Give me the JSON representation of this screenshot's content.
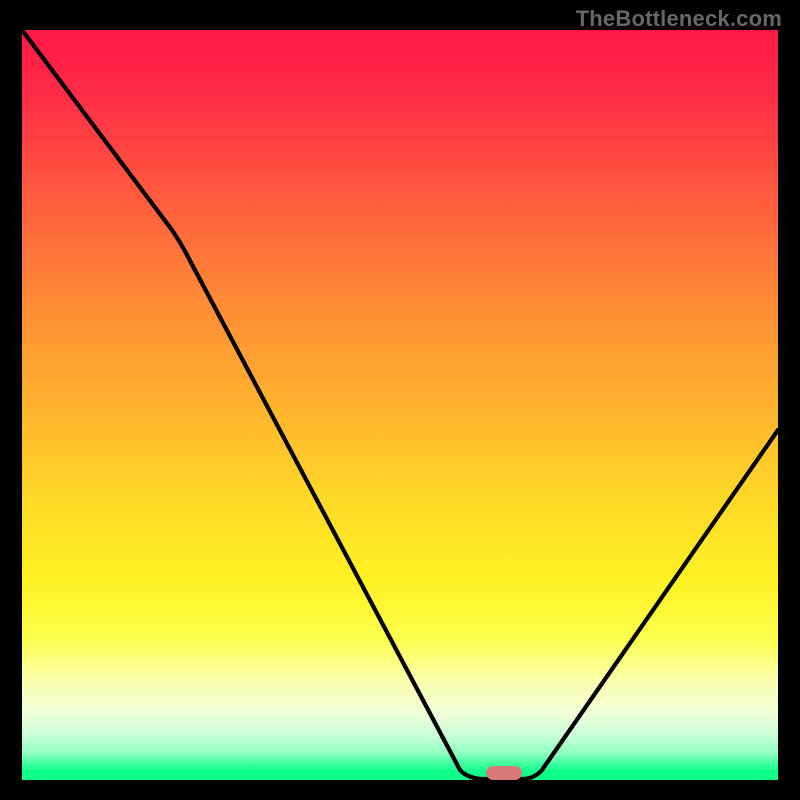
{
  "watermark": "TheBottleneck.com",
  "chart_data": {
    "type": "line",
    "title": "",
    "xlabel": "",
    "ylabel": "",
    "xlim": [
      0,
      100
    ],
    "ylim": [
      0,
      100
    ],
    "x": [
      0,
      20,
      58,
      63,
      67,
      100
    ],
    "values": [
      100,
      73,
      1,
      0,
      0,
      47
    ],
    "marker": {
      "x_start": 62,
      "x_end": 67,
      "y": 0
    },
    "background_gradient": [
      {
        "pos": 0,
        "color": "#ff1845"
      },
      {
        "pos": 0.5,
        "color": "#ffb22e"
      },
      {
        "pos": 0.73,
        "color": "#fff122"
      },
      {
        "pos": 0.96,
        "color": "#8effbe"
      },
      {
        "pos": 1.0,
        "color": "#00ff85"
      }
    ]
  }
}
